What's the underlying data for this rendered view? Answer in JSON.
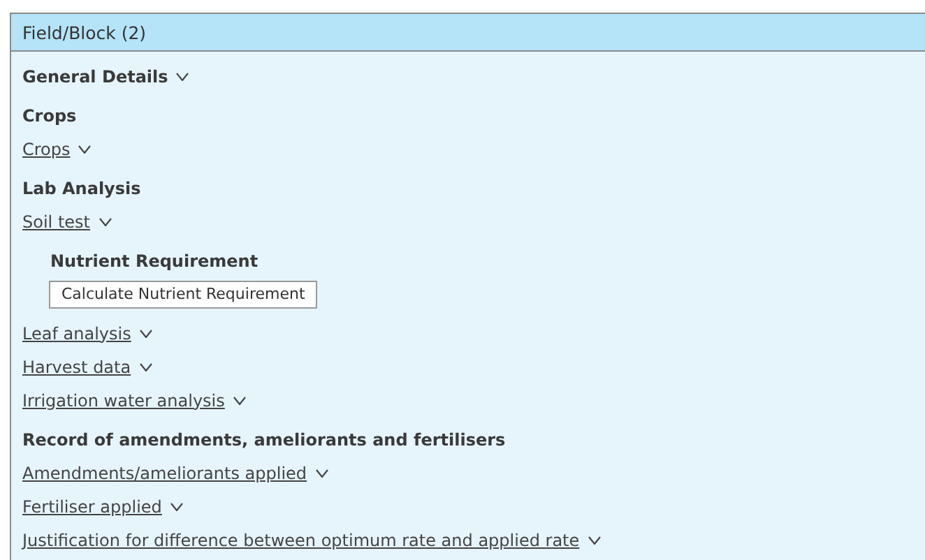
{
  "panel": {
    "title": "Field/Block (2)"
  },
  "sections": [
    {
      "title": "General Details",
      "chevron": true
    },
    {
      "title": "Crops",
      "chevron": false,
      "items": [
        {
          "kind": "link",
          "label": "Crops",
          "chevron": true
        }
      ]
    },
    {
      "title": "Lab Analysis",
      "chevron": false,
      "items": [
        {
          "kind": "link",
          "label": "Soil test",
          "chevron": true
        },
        {
          "kind": "subheading",
          "label": "Nutrient Requirement"
        },
        {
          "kind": "button",
          "label": "Calculate Nutrient Requirement"
        },
        {
          "kind": "link",
          "label": "Leaf analysis",
          "chevron": true
        },
        {
          "kind": "link",
          "label": "Harvest data",
          "chevron": true
        },
        {
          "kind": "link",
          "label": "Irrigation water analysis",
          "chevron": true
        }
      ]
    },
    {
      "title": "Record of amendments, ameliorants and fertilisers",
      "chevron": false,
      "items": [
        {
          "kind": "link",
          "label": "Amendments/ameliorants applied",
          "chevron": true
        },
        {
          "kind": "link",
          "label": "Fertiliser applied",
          "chevron": true
        },
        {
          "kind": "link",
          "label": "Justification for difference between optimum rate and applied rate",
          "chevron": true
        }
      ]
    }
  ]
}
